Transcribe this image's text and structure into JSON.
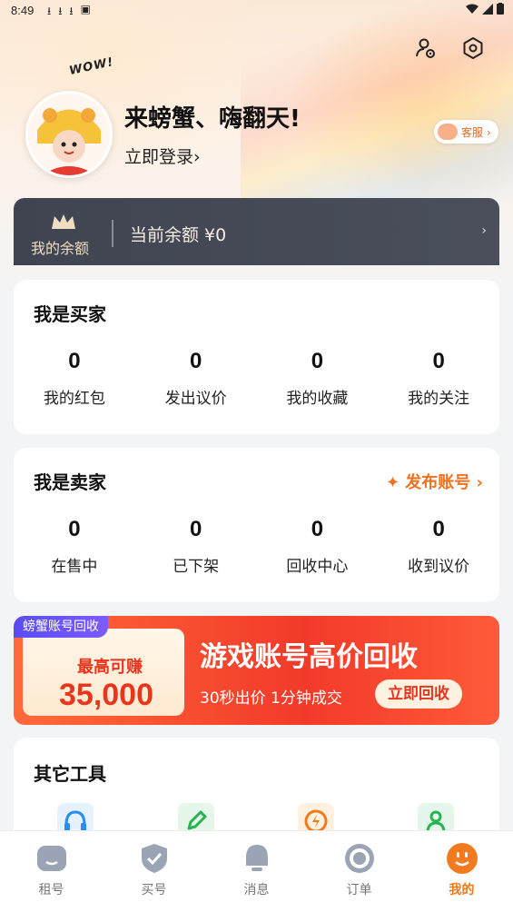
{
  "status_bar": {
    "time": "8:49"
  },
  "header": {
    "wow_sticker": "WOW!",
    "headline": "来螃蟹、嗨翻天!",
    "login_label": "立即登录›",
    "service_label": "客服 ›"
  },
  "balance": {
    "title": "我的余额",
    "amount_text": "当前余额 ¥0",
    "arrow": "›"
  },
  "buyer": {
    "title": "我是买家",
    "stats": [
      {
        "value": "0",
        "label": "我的红包"
      },
      {
        "value": "0",
        "label": "发出议价"
      },
      {
        "value": "0",
        "label": "我的收藏"
      },
      {
        "value": "0",
        "label": "我的关注"
      }
    ]
  },
  "seller": {
    "title": "我是卖家",
    "publish_label": "✦ 发布账号 ›",
    "stats": [
      {
        "value": "0",
        "label": "在售中"
      },
      {
        "value": "0",
        "label": "已下架"
      },
      {
        "value": "0",
        "label": "回收中心"
      },
      {
        "value": "0",
        "label": "收到议价"
      }
    ]
  },
  "promo": {
    "tag": "螃蟹账号回收",
    "max_label": "最高可赚",
    "amount": "35,000",
    "headline": "游戏账号高价回收",
    "subtext": "30秒出价 1分钟成交",
    "button_label": "立即回收"
  },
  "tools": {
    "title": "其它工具",
    "icons": [
      "headset-icon",
      "edit-icon",
      "lightning-icon",
      "person-icon"
    ]
  },
  "tabbar": {
    "tabs": [
      {
        "label": "租号",
        "icon": "rent-icon",
        "active": false
      },
      {
        "label": "买号",
        "icon": "shield-check-icon",
        "active": false
      },
      {
        "label": "消息",
        "icon": "bell-icon",
        "active": false
      },
      {
        "label": "订单",
        "icon": "order-ring-icon",
        "active": false
      },
      {
        "label": "我的",
        "icon": "smile-icon",
        "active": true
      }
    ]
  },
  "colors": {
    "accent": "#f07a1a",
    "promo_red": "#f23a2a",
    "balance_dark": "#3f4450"
  }
}
